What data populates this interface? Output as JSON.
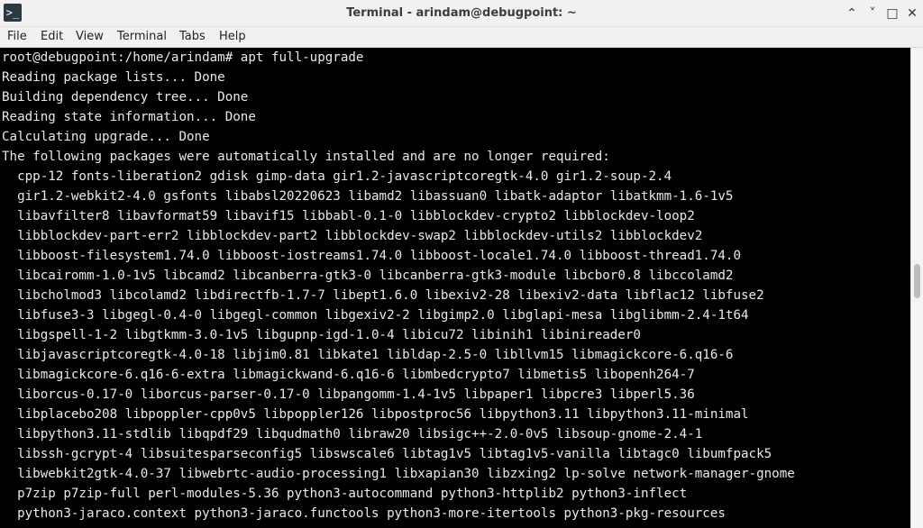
{
  "window": {
    "title": "Terminal - arindam@debugpoint: ~",
    "controls": {
      "minimize": "⌃",
      "restore": "˅",
      "maximize": "□",
      "close": "✕"
    }
  },
  "menu": [
    "File",
    "Edit",
    "View",
    "Terminal",
    "Tabs",
    "Help"
  ],
  "terminal": {
    "lines": [
      "root@debugpoint:/home/arindam# apt full-upgrade",
      "Reading package lists... Done",
      "Building dependency tree... Done",
      "Reading state information... Done",
      "Calculating upgrade... Done",
      "The following packages were automatically installed and are no longer required:",
      "  cpp-12 fonts-liberation2 gdisk gimp-data gir1.2-javascriptcoregtk-4.0 gir1.2-soup-2.4",
      "  gir1.2-webkit2-4.0 gsfonts libabsl20220623 libamd2 libassuan0 libatk-adaptor libatkmm-1.6-1v5",
      "  libavfilter8 libavformat59 libavif15 libbabl-0.1-0 libblockdev-crypto2 libblockdev-loop2",
      "  libblockdev-part-err2 libblockdev-part2 libblockdev-swap2 libblockdev-utils2 libblockdev2",
      "  libboost-filesystem1.74.0 libboost-iostreams1.74.0 libboost-locale1.74.0 libboost-thread1.74.0",
      "  libcairomm-1.0-1v5 libcamd2 libcanberra-gtk3-0 libcanberra-gtk3-module libcbor0.8 libccolamd2",
      "  libcholmod3 libcolamd2 libdirectfb-1.7-7 libept1.6.0 libexiv2-28 libexiv2-data libflac12 libfuse2",
      "  libfuse3-3 libgegl-0.4-0 libgegl-common libgexiv2-2 libgimp2.0 libglapi-mesa libglibmm-2.4-1t64",
      "  libgspell-1-2 libgtkmm-3.0-1v5 libgupnp-igd-1.0-4 libicu72 libinih1 libinireader0",
      "  libjavascriptcoregtk-4.0-18 libjim0.81 libkate1 libldap-2.5-0 libllvm15 libmagickcore-6.q16-6",
      "  libmagickcore-6.q16-6-extra libmagickwand-6.q16-6 libmbedcrypto7 libmetis5 libopenh264-7",
      "  liborcus-0.17-0 liborcus-parser-0.17-0 libpangomm-1.4-1v5 libpaper1 libpcre3 libperl5.36",
      "  libplacebo208 libpoppler-cpp0v5 libpoppler126 libpostproc56 libpython3.11 libpython3.11-minimal",
      "  libpython3.11-stdlib libqpdf29 libqudmath0 libraw20 libsigc++-2.0-0v5 libsoup-gnome-2.4-1",
      "  libssh-gcrypt-4 libsuitesparseconfig5 libswscale6 libtag1v5 libtag1v5-vanilla libtagc0 libumfpack5",
      "  libwebkit2gtk-4.0-37 libwebrtc-audio-processing1 libxapian30 libzxing2 lp-solve network-manager-gnome",
      "  p7zip p7zip-full perl-modules-5.36 python3-autocommand python3-httplib2 python3-inflect",
      "  python3-jaraco.context python3-jaraco.functools python3-more-itertools python3-pkg-resources"
    ]
  }
}
